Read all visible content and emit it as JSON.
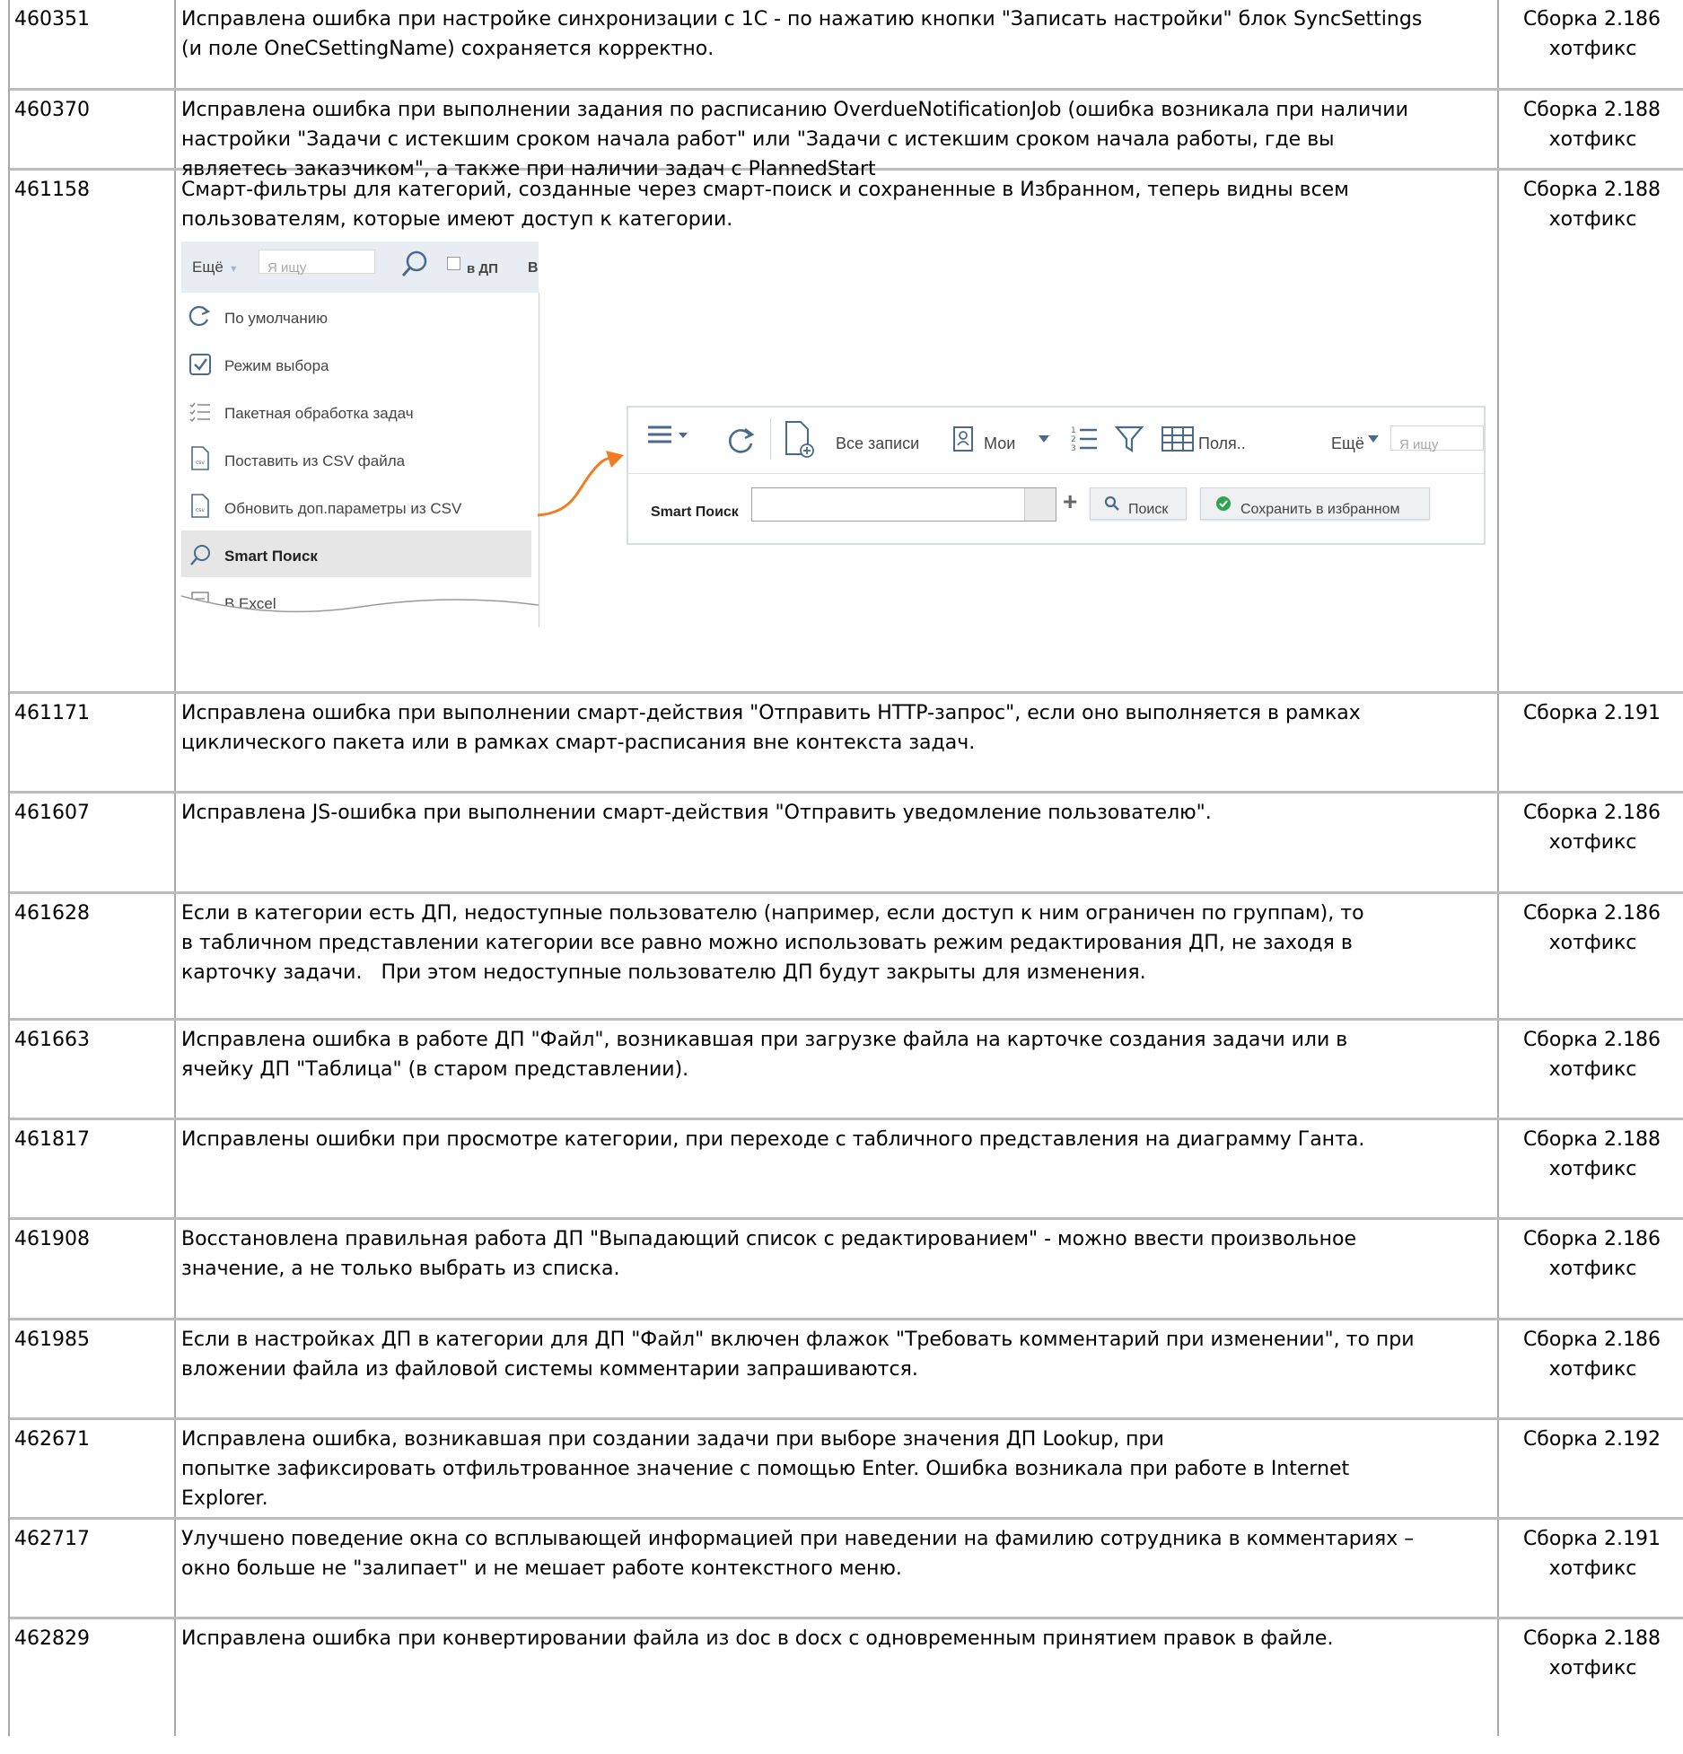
{
  "rows": [
    {
      "id": "460351",
      "lines": [
        "Исправлена ошибка при настройке синхронизации с 1С - по нажатию кнопки \"Записать настройки\" блок SyncSettings",
        "(и поле OneCSettingName) сохраняется корректно."
      ],
      "version": "Сборка 2.186",
      "note": "хотфикс"
    },
    {
      "id": "460370",
      "lines": [
        "Исправлена ошибка при выполнении задания по расписанию OverdueNotificationJob (ошибка возникала при наличии",
        "настройки \"Задачи с истекшим сроком начала работ\" или \"Задачи с истекшим сроком начала работы, где вы",
        "являетесь заказчиком\", а также при наличии задач с PlannedStart"
      ],
      "version": "Сборка 2.188",
      "note": "хотфикс"
    },
    {
      "id": "461158",
      "lines": [
        "Смарт-фильтры для категорий, созданные через смарт-поиск и сохраненные в Избранном, теперь видны всем",
        "пользователям, которые имеют доступ к категории."
      ],
      "version": "Сборка 2.188",
      "note": "хотфикс"
    },
    {
      "id": "461171",
      "lines": [
        "Исправлена ошибка при выполнении смарт-действия \"Отправить HTTP-запрос\", если оно выполняется в рамках",
        "циклического пакета или в рамках смарт-расписания вне контекста задач."
      ],
      "version": "Сборка 2.191",
      "note": ""
    },
    {
      "id": "461607",
      "lines": [
        "Исправлена JS-ошибка при выполнении смарт-действия \"Отправить уведомление пользователю\"."
      ],
      "version": "Сборка 2.186",
      "note": "хотфикс"
    },
    {
      "id": "461628",
      "lines": [
        "Если в категории есть ДП, недоступные пользователю (например, если доступ к ним ограничен по группам), то",
        "в табличном представлении категории все равно можно использовать режим редактирования ДП, не заходя в",
        "карточку задачи.   При этом недоступные пользователю ДП будут закрыты для изменения."
      ],
      "version": "Сборка 2.186",
      "note": "хотфикс"
    },
    {
      "id": "461663",
      "lines": [
        "Исправлена ошибка в работе ДП \"Файл\", возникавшая при загрузке файла на карточке создания задачи или в",
        "ячейку ДП \"Таблица\" (в старом представлении)."
      ],
      "version": "Сборка 2.186",
      "note": "хотфикс"
    },
    {
      "id": "461817",
      "lines": [
        "Исправлены ошибки при просмотре категории, при переходе с табличного представления на диаграмму Ганта."
      ],
      "version": "Сборка 2.188",
      "note": "хотфикс"
    },
    {
      "id": "461908",
      "lines": [
        "Восстановлена правильная работа ДП \"Выпадающий список с редактированием\" - можно ввести произвольное",
        "значение, а не только выбрать из списка."
      ],
      "version": "Сборка 2.186",
      "note": "хотфикс"
    },
    {
      "id": "461985",
      "lines": [
        "Если в настройках ДП в категории для ДП \"Файл\" включен флажок \"Требовать комментарий при изменении\", то при",
        "вложении файла из файловой системы комментарии запрашиваются."
      ],
      "version": "Сборка 2.186",
      "note": "хотфикс"
    },
    {
      "id": "462671",
      "lines": [
        "Исправлена ошибка, возникавшая при создании задачи при выборе значения ДП Lookup, при",
        "попытке зафиксировать отфильтрованное значение с помощью Enter. Ошибка возникала при работе в Internet",
        "Explorer."
      ],
      "version": "Сборка 2.192",
      "note": ""
    },
    {
      "id": "462717",
      "lines": [
        "Улучшено поведение окна со всплывающей информацией при наведении на фамилию сотрудника в комментариях –",
        "окно больше не \"залипает\" и не мешает работе контекстного меню."
      ],
      "version": "Сборка 2.191",
      "note": "хотфикс"
    },
    {
      "id": "462829",
      "lines": [
        "Исправлена ошибка при конвертировании файла из doc в docx с одновременным принятием правок в файле."
      ],
      "version": "Сборка 2.188",
      "note": "хотфикс"
    }
  ],
  "screenshot": {
    "menu": {
      "more": "Ещё",
      "search_placeholder": "Я ищу",
      "checkbox_label": "в ДП",
      "cut_label": "В",
      "items": [
        "По умолчанию",
        "Режим выбора",
        "Пакетная обработка задач",
        "Поставить из CSV файла",
        "Обновить доп.параметры из CSV",
        "Smart Поиск",
        "В Excel"
      ],
      "csv_badge": "csv"
    },
    "panel": {
      "all_records": "Все записи",
      "mine": "Мои",
      "fields": "Поля..",
      "more": "Ещё",
      "search_placeholder": "Я ищу",
      "smart_label": "Smart Поиск",
      "search_button": "Поиск",
      "save_button": "Сохранить в избранном"
    },
    "colors": {
      "grid": "#a9a9a9",
      "arrow": "#f07d22",
      "toolbar_icon": "#4a6a8c",
      "save_ok": "#2ea44f"
    }
  }
}
